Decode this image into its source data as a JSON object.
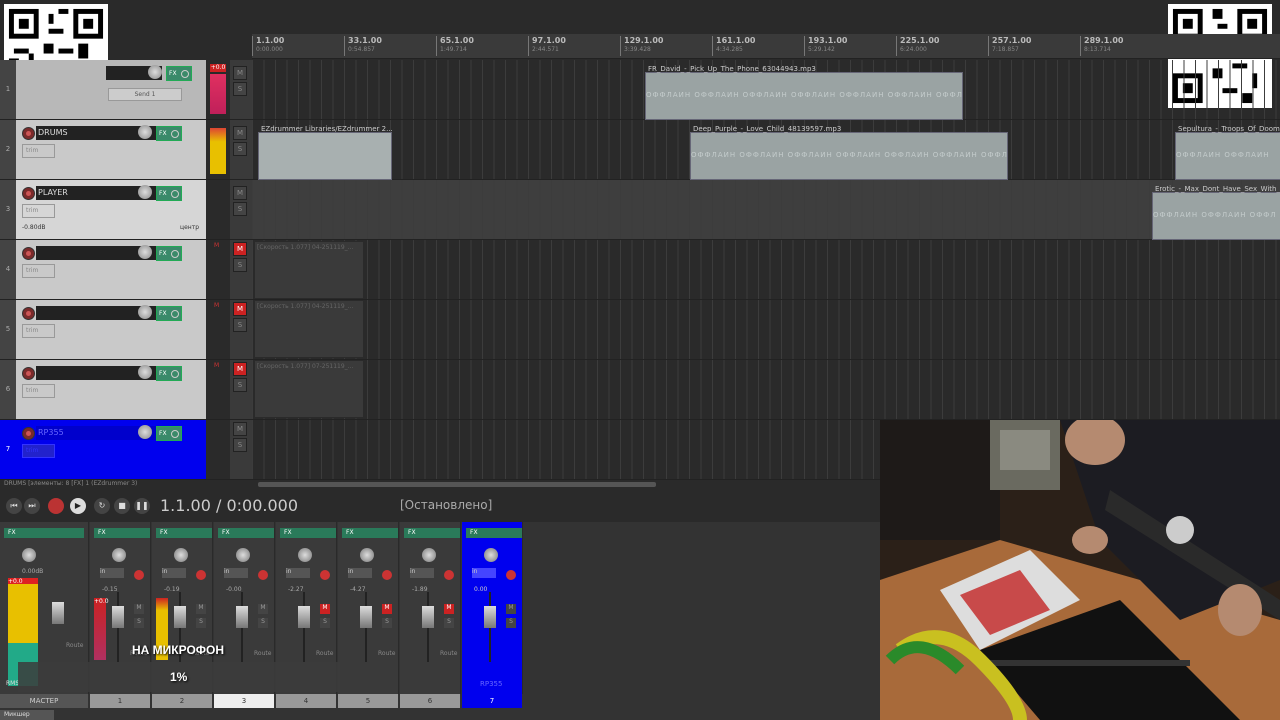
{
  "ruler": {
    "marks": [
      {
        "bar": "1.1.00",
        "time": "0:00.000"
      },
      {
        "bar": "33.1.00",
        "time": "0:54.857"
      },
      {
        "bar": "65.1.00",
        "time": "1:49.714"
      },
      {
        "bar": "97.1.00",
        "time": "2:44.571"
      },
      {
        "bar": "129.1.00",
        "time": "3:39.428"
      },
      {
        "bar": "161.1.00",
        "time": "4:34.285"
      },
      {
        "bar": "193.1.00",
        "time": "5:29.142"
      },
      {
        "bar": "225.1.00",
        "time": "6:24.000"
      },
      {
        "bar": "257.1.00",
        "time": "7:18.857"
      },
      {
        "bar": "289.1.00",
        "time": "8:13.714"
      }
    ]
  },
  "tracks": [
    {
      "num": "1",
      "name": "",
      "send": "Send 1"
    },
    {
      "num": "2",
      "name": "DRUMS",
      "trim": "trim"
    },
    {
      "num": "3",
      "name": "PLAYER",
      "trim": "trim",
      "volume": "-0.80dB",
      "pan": "центр"
    },
    {
      "num": "4",
      "name": "",
      "trim": "trim"
    },
    {
      "num": "5",
      "name": "",
      "trim": "trim"
    },
    {
      "num": "6",
      "name": "",
      "trim": "trim"
    },
    {
      "num": "7",
      "name": "RP355",
      "trim": "trim"
    }
  ],
  "fx_label": "FX",
  "mute_label": "M",
  "solo_label": "S",
  "peak_label": "+0.0",
  "items": {
    "t1": {
      "title": "FR_David_-_Pick_Up_The_Phone_63044943.mp3",
      "offline": "ОФФЛАЙН ОФФЛАЙН ОФФЛАЙН ОФФЛАЙН ОФФЛАЙН ОФФЛАЙН ОФФЛ"
    },
    "t2a": {
      "title": "EZdrummer Libraries/EZdrummer 2..."
    },
    "t2b": {
      "title": "Deep_Purple_-_Love_Child_48139597.mp3",
      "offline": "ОФФЛАЙН ОФФЛАЙН ОФФЛАЙН ОФФЛАЙН ОФФЛАЙН ОФФЛАЙН ОФФЛ"
    },
    "t2c": {
      "title": "Sepultura_-_Troops_Of_Doom_...",
      "offline": "ОФФЛАЙН ОФФЛАЙН"
    },
    "t3": {
      "title": "Erotic_-_Max_Dont_Have_Sex_With_Y...",
      "offline": "ОФФЛАЙН ОФФЛАЙН ОФФЛ"
    },
    "g4": "[Скорость 1.077] 04-251119_...",
    "g5": "[Скорость 1.077] 04-251119_...",
    "g6": "[Скорость 1.077] 07-251119_..."
  },
  "status_line": "DRUMS [элементы: 8 [FX] 1 (EZdrummer 3)",
  "transport": {
    "position": "1.1.00 / 0:00.000",
    "state": "[Остановлено]"
  },
  "mixer": {
    "master_label": "МАСТЕР",
    "master_vol": "0.00dB",
    "rms_label": "RMS",
    "route_label": "Route",
    "in_label": "in",
    "strips": [
      {
        "label": "1",
        "vol": "-0.15"
      },
      {
        "label": "2",
        "vol": "-0.19"
      },
      {
        "label": "3",
        "vol": "-0.00"
      },
      {
        "label": "4",
        "vol": "-2.27"
      },
      {
        "label": "5",
        "vol": "-4.27"
      },
      {
        "label": "6",
        "vol": "-1.89"
      },
      {
        "label": "7",
        "vol": "0.00",
        "name": "RP355"
      }
    ]
  },
  "overlay": {
    "mic": "НА МИКРОФОН",
    "percent": "1%"
  },
  "bottom_tab": "Микшер"
}
